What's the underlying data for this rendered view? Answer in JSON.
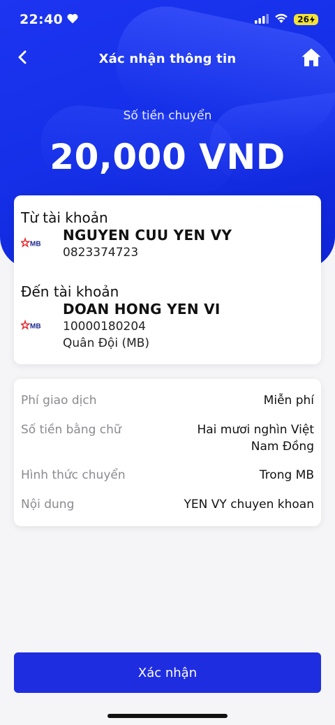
{
  "status_bar": {
    "time": "22:40",
    "battery": "26"
  },
  "nav": {
    "title": "Xác nhận thông tin"
  },
  "amount": {
    "label": "Số tiền chuyển",
    "value": "20,000 VND"
  },
  "from": {
    "label": "Từ tài khoản",
    "name": "NGUYEN CUU YEN VY",
    "number": "0823374723",
    "logo": "MB"
  },
  "to": {
    "label": "Đến tài khoản",
    "name": "DOAN HONG YEN VI",
    "number": "10000180204",
    "bank": "Quân Đội (MB)",
    "logo": "MB"
  },
  "details": {
    "fee_label": "Phí giao dịch",
    "fee_value": "Miễn phí",
    "words_label": "Số tiền bằng chữ",
    "words_value_line1": "Hai mươi nghìn Việt",
    "words_value_line2": "Nam Đồng",
    "method_label": "Hình thức chuyển",
    "method_value": "Trong MB",
    "content_label": "Nội dung",
    "content_value": "YEN VY chuyen khoan"
  },
  "actions": {
    "confirm_label": "Xác nhận"
  },
  "colors": {
    "brand_blue": "#1f2de0",
    "hero_blue": "#1530e8",
    "mb_red": "#e3262b",
    "mb_navy": "#1b2a8c",
    "battery_yellow": "#f2e23a"
  },
  "icons": {
    "back": "chevron-left-icon",
    "home": "home-icon",
    "heart": "heart-icon",
    "signal": "signal-icon",
    "wifi": "wifi-icon",
    "battery": "battery-icon",
    "bank_logo": "mb-bank-logo"
  }
}
